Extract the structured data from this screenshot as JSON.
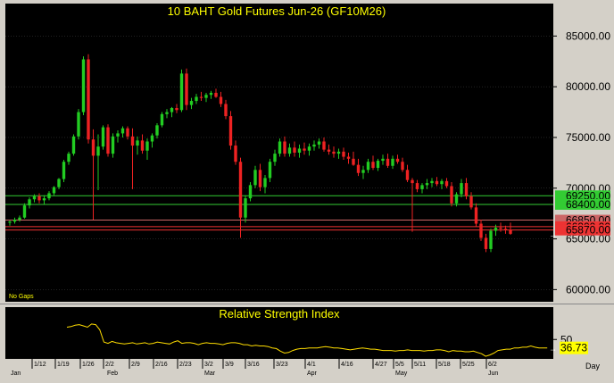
{
  "chart_data": [
    {
      "type": "candlestick",
      "title": "10 BAHT  Gold Futures Jun-26  (GF10M26)",
      "note": "No Gaps",
      "ylim": [
        58800,
        88200
      ],
      "y_ticks": [
        60000,
        65000,
        70000,
        75000,
        80000,
        85000
      ],
      "y_tick_labels": [
        "60000.00",
        "65000.00",
        "70000.00",
        "75000.00",
        "80000.00",
        "85000.00"
      ],
      "x_tick_labels": [
        "1/12",
        "1/19",
        "1/26",
        "2/2",
        "2/9",
        "2/16",
        "2/23",
        "3/2",
        "3/9",
        "3/16",
        "3/23",
        "4/1",
        "4/16",
        "4/27",
        "5/5",
        "5/11",
        "5/18",
        "5/25",
        "6/2"
      ],
      "month_labels": [
        "Jan",
        "Feb",
        "Mar",
        "Apr",
        "May",
        "Jun"
      ],
      "x_axis_unit": "Day",
      "horizontal_levels": [
        {
          "value": 69250,
          "label": "69250.00",
          "color": "#33cc33"
        },
        {
          "value": 68400,
          "label": "68400.00",
          "color": "#33cc33"
        },
        {
          "value": 66850,
          "label": "66850.00",
          "color": "#cc6666"
        },
        {
          "value": 66200,
          "label": "66200.00",
          "color": "#ee3333"
        },
        {
          "value": 65870,
          "label": "65870.00",
          "color": "#ee3333"
        }
      ],
      "candles": [
        [
          66600,
          66800,
          66300,
          66700
        ],
        [
          66700,
          67100,
          66500,
          66900
        ],
        [
          66900,
          67300,
          66700,
          67100
        ],
        [
          67100,
          68500,
          67000,
          68300
        ],
        [
          68300,
          69100,
          68000,
          68900
        ],
        [
          68900,
          69400,
          68600,
          69200
        ],
        [
          69200,
          69500,
          68500,
          68800
        ],
        [
          68800,
          69300,
          68400,
          69000
        ],
        [
          69000,
          69700,
          68800,
          69500
        ],
        [
          69500,
          70200,
          69300,
          70100
        ],
        [
          70100,
          71000,
          69900,
          70900
        ],
        [
          70900,
          72800,
          70600,
          72600
        ],
        [
          72600,
          73600,
          72300,
          73400
        ],
        [
          73400,
          75300,
          73200,
          75100
        ],
        [
          75100,
          77800,
          74800,
          77500
        ],
        [
          77500,
          83000,
          77200,
          82700
        ],
        [
          82700,
          83200,
          74400,
          74800
        ],
        [
          74800,
          75800,
          66900,
          73200
        ],
        [
          73200,
          75300,
          69800,
          74100
        ],
        [
          74100,
          76200,
          73800,
          76000
        ],
        [
          76000,
          76300,
          73100,
          73400
        ],
        [
          73400,
          75400,
          73000,
          75100
        ],
        [
          75100,
          75700,
          74500,
          75400
        ],
        [
          75400,
          76100,
          75000,
          75900
        ],
        [
          75900,
          76100,
          74800,
          75100
        ],
        [
          75100,
          75900,
          69900,
          74200
        ],
        [
          74200,
          75100,
          73300,
          74700
        ],
        [
          74700,
          75300,
          73400,
          73700
        ],
        [
          73700,
          74900,
          72800,
          74600
        ],
        [
          74600,
          75400,
          74000,
          75200
        ],
        [
          75200,
          76400,
          74900,
          76200
        ],
        [
          76200,
          77500,
          76000,
          77300
        ],
        [
          77300,
          77800,
          76900,
          77500
        ],
        [
          77500,
          78000,
          77000,
          77900
        ],
        [
          77900,
          78300,
          77400,
          77700
        ],
        [
          77700,
          81700,
          77500,
          81300
        ],
        [
          81300,
          81800,
          77700,
          78200
        ],
        [
          78200,
          78900,
          77800,
          78600
        ],
        [
          78600,
          79300,
          78300,
          79000
        ],
        [
          79000,
          79500,
          78600,
          78900
        ],
        [
          78900,
          79400,
          78500,
          79200
        ],
        [
          79200,
          79600,
          78800,
          79400
        ],
        [
          79400,
          79800,
          78900,
          79000
        ],
        [
          79000,
          79500,
          78000,
          78300
        ],
        [
          78300,
          78700,
          76800,
          77100
        ],
        [
          77100,
          77600,
          73800,
          74200
        ],
        [
          74200,
          74700,
          72300,
          72600
        ],
        [
          72600,
          73000,
          65100,
          67100
        ],
        [
          67100,
          69300,
          66600,
          69000
        ],
        [
          69000,
          70600,
          68700,
          70300
        ],
        [
          70300,
          72200,
          70000,
          71800
        ],
        [
          71800,
          72400,
          69700,
          70100
        ],
        [
          70100,
          71300,
          69500,
          71000
        ],
        [
          71000,
          72900,
          70600,
          72600
        ],
        [
          72600,
          73800,
          72200,
          73400
        ],
        [
          73400,
          74900,
          73100,
          74600
        ],
        [
          74600,
          75100,
          73100,
          73400
        ],
        [
          73400,
          74400,
          73100,
          74000
        ],
        [
          74000,
          74600,
          73100,
          73500
        ],
        [
          73500,
          74300,
          73000,
          73900
        ],
        [
          73900,
          74500,
          73300,
          73700
        ],
        [
          73700,
          74400,
          73200,
          74100
        ],
        [
          74100,
          74700,
          73700,
          74300
        ],
        [
          74300,
          74900,
          73900,
          74600
        ],
        [
          74600,
          75000,
          73600,
          73800
        ],
        [
          73800,
          74300,
          73300,
          73600
        ],
        [
          73600,
          74100,
          73000,
          73400
        ],
        [
          73400,
          73900,
          72900,
          73600
        ],
        [
          73600,
          74000,
          72800,
          73100
        ],
        [
          73100,
          73500,
          72400,
          72900
        ],
        [
          72900,
          73600,
          72200,
          72300
        ],
        [
          72300,
          72900,
          71200,
          71500
        ],
        [
          71500,
          72200,
          70900,
          71800
        ],
        [
          71800,
          72900,
          71500,
          72600
        ],
        [
          72600,
          73200,
          71800,
          72000
        ],
        [
          72000,
          72900,
          71700,
          72700
        ],
        [
          72700,
          73300,
          72300,
          72900
        ],
        [
          72900,
          73400,
          72000,
          72200
        ],
        [
          72200,
          73200,
          71900,
          72900
        ],
        [
          72900,
          73300,
          72400,
          72600
        ],
        [
          72600,
          73000,
          71600,
          71800
        ],
        [
          71800,
          72300,
          70600,
          70800
        ],
        [
          70800,
          71000,
          65700,
          70500
        ],
        [
          70500,
          70800,
          69600,
          69900
        ],
        [
          69900,
          70500,
          69500,
          70300
        ],
        [
          70300,
          70900,
          69900,
          70500
        ],
        [
          70500,
          71000,
          70100,
          70700
        ],
        [
          70700,
          71100,
          70200,
          70400
        ],
        [
          70400,
          70900,
          69900,
          70700
        ],
        [
          70700,
          71000,
          70000,
          70200
        ],
        [
          70200,
          70600,
          68200,
          68500
        ],
        [
          68500,
          69600,
          68200,
          69400
        ],
        [
          69400,
          70900,
          69100,
          70500
        ],
        [
          70500,
          71000,
          68900,
          69200
        ],
        [
          69200,
          69600,
          67900,
          68100
        ],
        [
          68100,
          68500,
          66200,
          66500
        ],
        [
          66500,
          66900,
          64800,
          65100
        ],
        [
          65100,
          65500,
          63700,
          64000
        ],
        [
          64000,
          66000,
          63700,
          65800
        ],
        [
          65800,
          66400,
          65300,
          66100
        ],
        [
          66100,
          66600,
          65700,
          66000
        ],
        [
          66000,
          66300,
          65500,
          65900
        ],
        [
          65900,
          66600,
          65400,
          65500
        ]
      ]
    },
    {
      "type": "line",
      "title": "Relative Strength Index",
      "y_tick_labels": [
        "50"
      ],
      "ylim": [
        20,
        100
      ],
      "last_value_label": "36.73",
      "values": [
        69,
        70,
        72,
        73,
        71,
        69,
        74,
        73,
        65,
        46,
        44,
        47,
        45,
        44,
        43,
        44,
        45,
        43,
        44,
        45,
        43,
        44,
        46,
        45,
        44,
        43,
        46,
        48,
        44,
        45,
        45,
        44,
        42,
        44,
        45,
        44,
        44,
        43,
        42,
        44,
        45,
        45,
        44,
        42,
        42,
        40,
        41,
        40,
        40,
        39,
        37,
        36,
        32,
        29,
        30,
        33,
        35,
        36,
        36,
        37,
        37,
        37,
        38,
        39,
        38,
        37,
        37,
        36,
        35,
        34,
        35,
        36,
        37,
        36,
        35,
        35,
        34,
        33,
        33,
        33,
        32,
        33,
        33,
        34,
        33,
        33,
        33,
        32,
        33,
        33,
        34,
        34,
        33,
        31,
        33,
        32,
        32,
        31,
        31,
        32,
        30,
        28,
        24,
        26,
        29,
        33,
        34,
        35,
        35,
        37,
        37,
        38,
        38,
        40,
        38,
        37,
        37,
        37
      ]
    }
  ],
  "colors": {
    "background": "#000000",
    "frame": "#d4d0c8",
    "title_text": "#ffff00",
    "axis_text": "#000000",
    "grid": "#444444",
    "candle_up": "#22cc22",
    "candle_down": "#ee2222",
    "rsi_line": "#ffdd00",
    "label_box": "#ffff00"
  }
}
